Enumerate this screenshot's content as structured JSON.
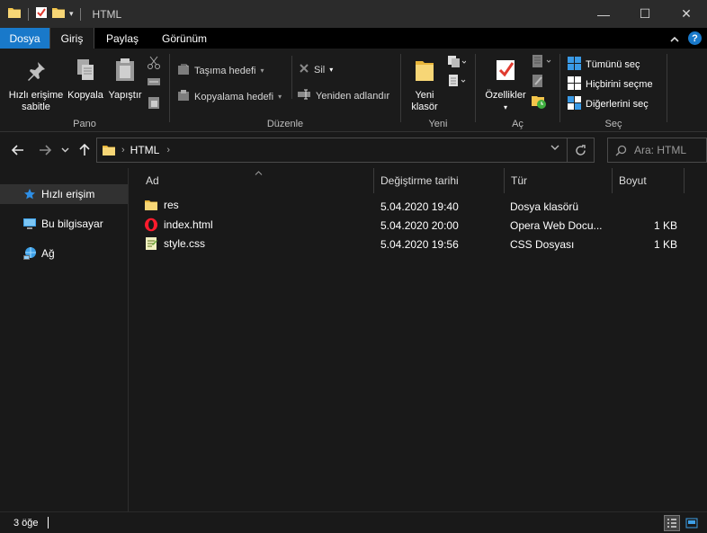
{
  "window": {
    "title": "HTML",
    "minimize": "—",
    "maximize": "☐",
    "close": "✕"
  },
  "tabs": [
    {
      "label": "Dosya"
    },
    {
      "label": "Giriş"
    },
    {
      "label": "Paylaş"
    },
    {
      "label": "Görünüm"
    }
  ],
  "ribbon": {
    "pano": {
      "label": "Pano",
      "pin_line1": "Hızlı erişime",
      "pin_line2": "sabitle",
      "copy": "Kopyala",
      "paste": "Yapıştır"
    },
    "duzenle": {
      "label": "Düzenle",
      "move_to": "Taşıma hedefi",
      "copy_to": "Kopyalama hedefi",
      "delete": "Sil",
      "rename": "Yeniden adlandır"
    },
    "yeni": {
      "label": "Yeni",
      "new_folder_line1": "Yeni",
      "new_folder_line2": "klasör"
    },
    "ac": {
      "label": "Aç",
      "properties": "Özellikler"
    },
    "sec": {
      "label": "Seç",
      "select_all": "Tümünü seç",
      "select_none": "Hiçbirini seçme",
      "invert": "Diğerlerini seç"
    }
  },
  "address": {
    "crumb": "HTML"
  },
  "search": {
    "placeholder": "Ara: HTML"
  },
  "nav": {
    "items": [
      {
        "label": "Hızlı erişim"
      },
      {
        "label": "Bu bilgisayar"
      },
      {
        "label": "Ağ"
      }
    ]
  },
  "columns": {
    "name": "Ad",
    "date": "Değiştirme tarihi",
    "type": "Tür",
    "size": "Boyut"
  },
  "files": [
    {
      "name": "res",
      "date": "5.04.2020 19:40",
      "type": "Dosya klasörü",
      "size": ""
    },
    {
      "name": "index.html",
      "date": "5.04.2020 20:00",
      "type": "Opera Web Docu...",
      "size": "1 KB"
    },
    {
      "name": "style.css",
      "date": "5.04.2020 19:56",
      "type": "CSS Dosyası",
      "size": "1 KB"
    }
  ],
  "status": {
    "count": "3 öğe"
  },
  "colors": {
    "file_tab": "#1979ca",
    "folder": "#f3c54b",
    "accent": "#1979ca"
  }
}
